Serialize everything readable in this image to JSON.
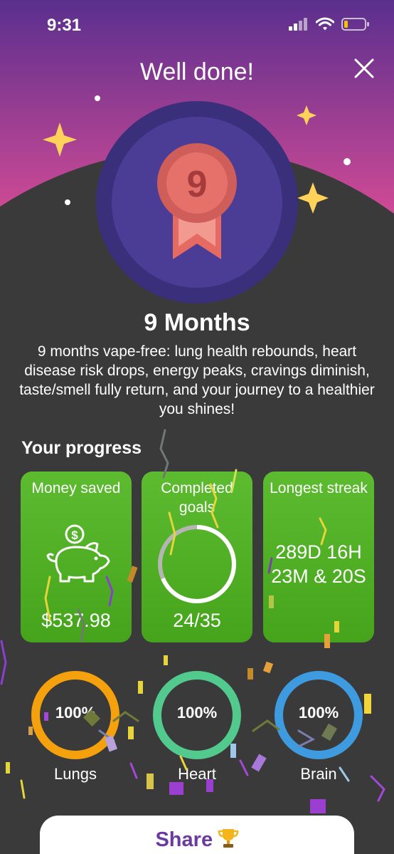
{
  "status_bar": {
    "time": "9:31"
  },
  "header": {
    "title": "Well done!"
  },
  "milestone": {
    "badge_number": "9",
    "title": "9 Months",
    "description": "9 months vape-free: lung health rebounds, heart disease risk drops, energy peaks, cravings diminish, taste/smell fully return, and your journey to a healthier you shines!"
  },
  "progress": {
    "title": "Your progress",
    "cards": [
      {
        "label": "Money saved",
        "value": "$537.98"
      },
      {
        "label": "Completed goals",
        "value": "24/35",
        "completed": 24,
        "total": 35
      },
      {
        "label": "Longest streak",
        "value": "289D 16H 23M & 20S"
      }
    ]
  },
  "health": [
    {
      "label": "Lungs",
      "value": "100%",
      "color": "#f5a10d"
    },
    {
      "label": "Heart",
      "value": "100%",
      "color": "#52c98d"
    },
    {
      "label": "Brain",
      "value": "100%",
      "color": "#3f9be0"
    }
  ],
  "actions": {
    "share_label": "Share"
  },
  "colors": {
    "header_gradient_top": "#5a2f8e",
    "header_gradient_bottom": "#d04a95",
    "background": "#3a3a3a",
    "card_green": "#52b226",
    "medal_navy": "#3a2f7a",
    "share_text": "#6a3aa0"
  },
  "icons": {
    "close": "close-icon",
    "money": "piggy-bank-icon",
    "badge": "medal-icon",
    "share": "trophy-icon"
  }
}
